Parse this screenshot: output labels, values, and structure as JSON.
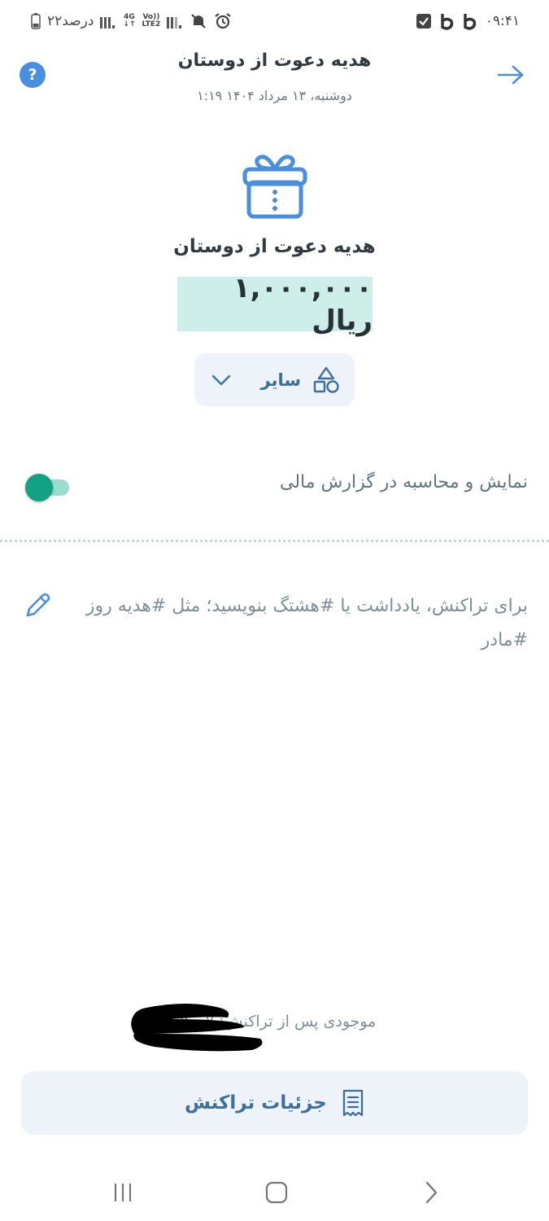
{
  "status_bar": {
    "time": "۰۹:۴۱",
    "battery": "۲۲درصد",
    "network_type": "4G",
    "network_lte": "LTE2",
    "volte": "Vo))"
  },
  "header": {
    "title": "هدیه دعوت از دوستان",
    "date": "دوشنبه، ۱۳ مرداد ۱۴۰۴ ۱:۱۹"
  },
  "transaction": {
    "category_title": "هدیه دعوت از دوستان",
    "amount": "۱,۰۰۰,۰۰۰ ریال",
    "category_selector": "سایر"
  },
  "report_toggle": {
    "label": "نمایش و محاسبه در گزارش مالی",
    "enabled": true
  },
  "note": {
    "placeholder": "برای تراکنش، یادداشت یا #هشتگ بنویسید؛ مثل #هدیه روز #مادر"
  },
  "balance": {
    "label": "موجودی پس از تراکنش: ۷ ریال"
  },
  "details_button": {
    "label": "جزئیات تراکنش"
  },
  "colors": {
    "accent": "#4a8ee0",
    "toggle_on": "#12a183",
    "amount_highlight": "#cdeee9",
    "button_bg": "#eef3f9",
    "button_text": "#3a6f9e"
  },
  "icons": {
    "back": "arrow-right-icon",
    "help": "question-circle-icon",
    "gift": "gift-icon",
    "category": "shapes-icon",
    "dropdown": "chevron-down-icon",
    "note_edit": "pencil-icon",
    "details": "receipt-icon"
  }
}
